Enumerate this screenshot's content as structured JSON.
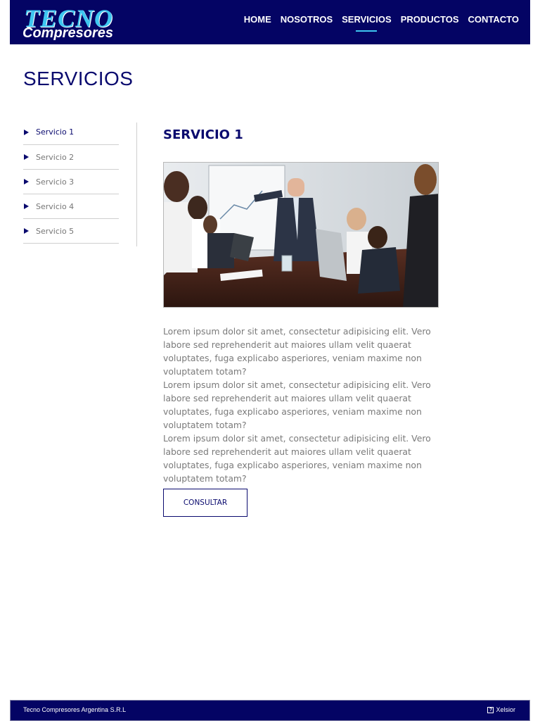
{
  "header": {
    "logo_line1": "TECNO",
    "logo_line2": "Compresores",
    "nav": [
      {
        "label": "HOME"
      },
      {
        "label": "NOSOTROS"
      },
      {
        "label": "SERVICIOS",
        "active": true
      },
      {
        "label": "PRODUCTOS"
      },
      {
        "label": "CONTACTO"
      }
    ]
  },
  "page": {
    "title": "SERVICIOS"
  },
  "sidebar": {
    "items": [
      {
        "label": "Servicio 1",
        "active": true
      },
      {
        "label": "Servicio 2"
      },
      {
        "label": "Servicio 3"
      },
      {
        "label": "Servicio 4"
      },
      {
        "label": "Servicio 5"
      }
    ]
  },
  "content": {
    "title": "SERVICIO 1",
    "paragraphs": [
      "Lorem ipsum dolor sit amet, consectetur adipisicing elit. Vero labore sed reprehenderit aut maiores ullam velit quaerat voluptates, fuga explicabo asperiores, veniam maxime non voluptatem totam?",
      "Lorem ipsum dolor sit amet, consectetur adipisicing elit. Vero labore sed reprehenderit aut maiores ullam velit quaerat voluptates, fuga explicabo asperiores, veniam maxime non voluptatem totam?",
      "Lorem ipsum dolor sit amet, consectetur adipisicing elit. Vero labore sed reprehenderit aut maiores ullam velit quaerat voluptates, fuga explicabo asperiores, veniam maxime non voluptatem totam?"
    ],
    "button_label": "CONSULTAR"
  },
  "footer": {
    "company": "Tecno Compresores Argentina S.R.L",
    "credit_icon": "?",
    "credit": "Xelsior"
  },
  "colors": {
    "navy": "#040464",
    "accent": "#3ec6f0",
    "text_dark": "#0a0a6e",
    "text_muted": "#7a7a7a"
  }
}
